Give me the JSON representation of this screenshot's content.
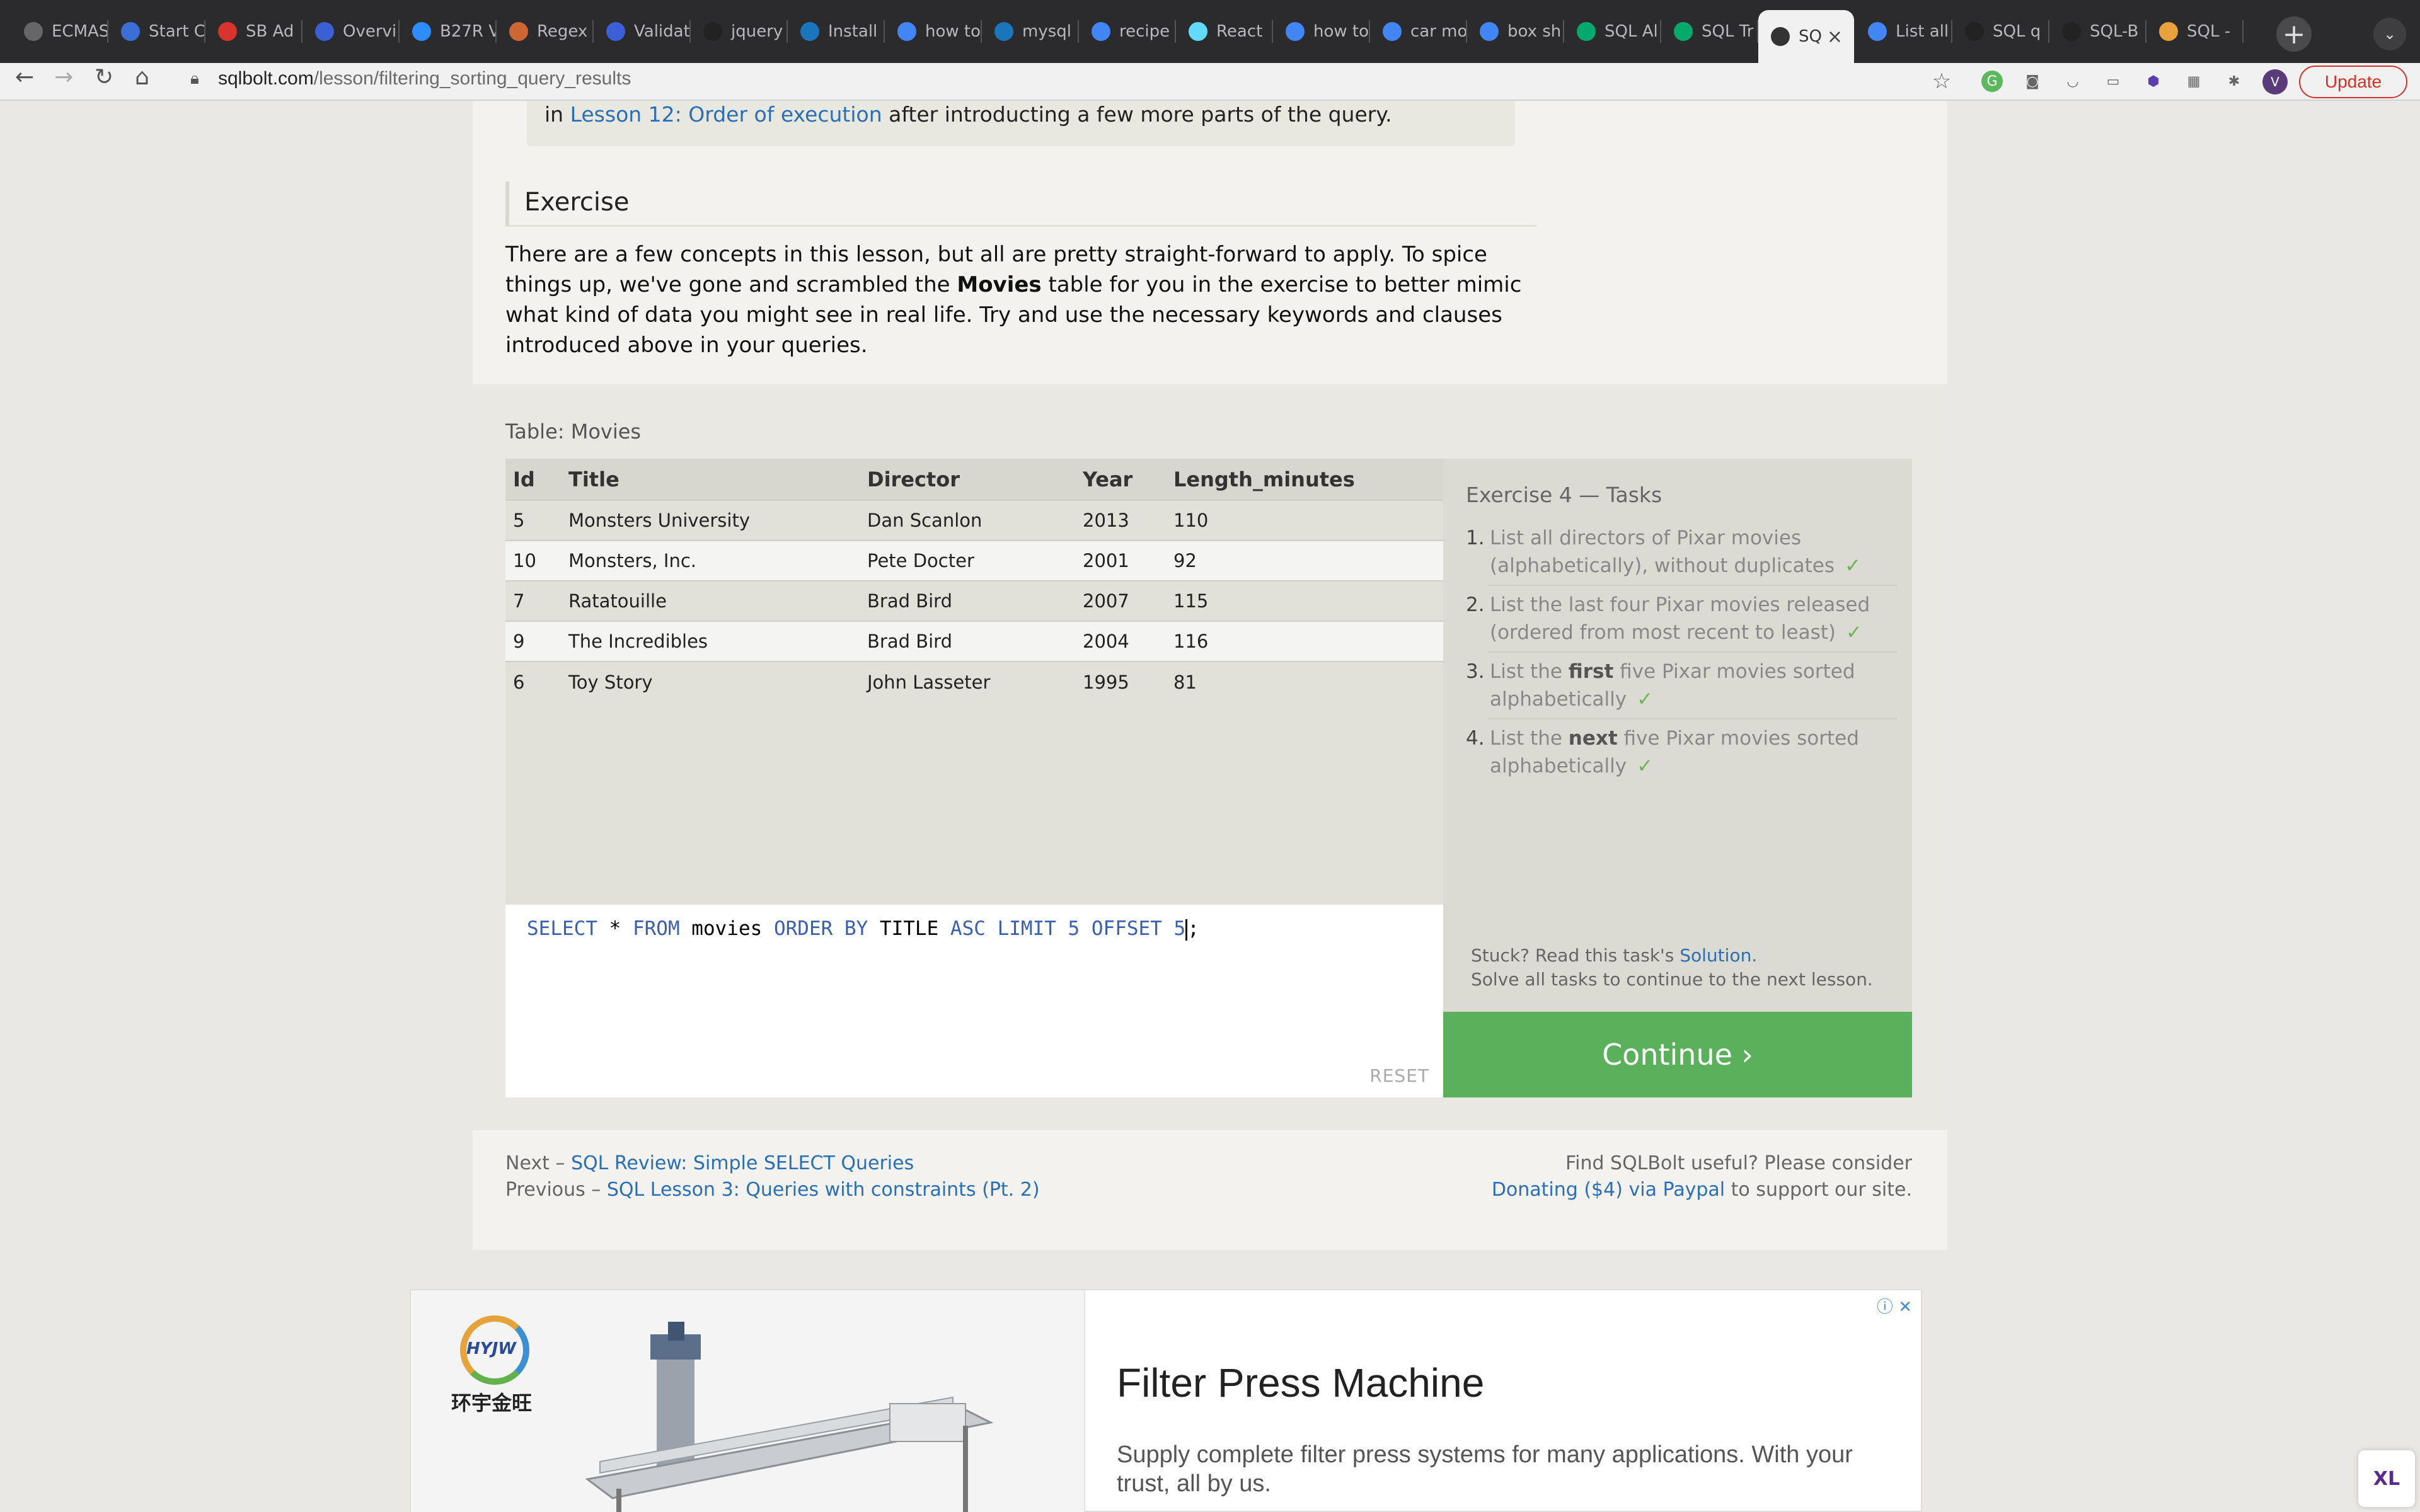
{
  "browser": {
    "tabs": [
      {
        "label": "ECMAS",
        "icon": "circle-icon",
        "color": "#666666"
      },
      {
        "label": "Start C",
        "icon": "flag-icon",
        "color": "#3b6fd6"
      },
      {
        "label": "SB Ad",
        "icon": "s-logo-icon",
        "color": "#d9342b"
      },
      {
        "label": "Overvi",
        "icon": "shield-icon",
        "color": "#3b5fd6"
      },
      {
        "label": "B27R V",
        "icon": "video-icon",
        "color": "#2d8cff"
      },
      {
        "label": "Regex",
        "icon": "regex-icon",
        "color": "#cc6633"
      },
      {
        "label": "Validat",
        "icon": "shield-icon",
        "color": "#3b5fd6"
      },
      {
        "label": "jquery",
        "icon": "github-icon",
        "color": "#222222"
      },
      {
        "label": "Install",
        "icon": "feather-icon",
        "color": "#1b75bb"
      },
      {
        "label": "how to",
        "icon": "google-icon",
        "color": "#4285f4"
      },
      {
        "label": "mysql",
        "icon": "feather-icon",
        "color": "#1b75bb"
      },
      {
        "label": "recipe",
        "icon": "google-icon",
        "color": "#4285f4"
      },
      {
        "label": "React",
        "icon": "react-icon",
        "color": "#61dafb"
      },
      {
        "label": "how to",
        "icon": "google-icon",
        "color": "#4285f4"
      },
      {
        "label": "car mo",
        "icon": "google-icon",
        "color": "#4285f4"
      },
      {
        "label": "box sh",
        "icon": "google-icon",
        "color": "#4285f4"
      },
      {
        "label": "SQL Al",
        "icon": "w3-icon",
        "color": "#04aa6d"
      },
      {
        "label": "SQL Tr",
        "icon": "w3-icon",
        "color": "#04aa6d"
      },
      {
        "label": "SQ",
        "icon": "table-icon",
        "color": "#333333",
        "active": true
      },
      {
        "label": "List all",
        "icon": "google-icon",
        "color": "#4285f4"
      },
      {
        "label": "SQL q",
        "icon": "github-icon",
        "color": "#222222"
      },
      {
        "label": "SQL-B",
        "icon": "github-icon",
        "color": "#222222"
      },
      {
        "label": "SQL -",
        "icon": "chart-icon",
        "color": "#e8a13b"
      }
    ],
    "url_host": "sqlbolt.com",
    "url_path": "/lesson/filtering_sorting_query_results",
    "update_label": "Update",
    "avatar_letter": "V"
  },
  "lesson": {
    "note_prefix": "in ",
    "note_link": "Lesson 12: Order of execution",
    "note_suffix": " after introducting a few more parts of the query.",
    "exercise_heading": "Exercise",
    "exercise_text_1": "There are a few concepts in this lesson, but all are pretty straight-forward to apply. To spice things up, we've gone and scrambled the ",
    "exercise_text_bold": "Movies",
    "exercise_text_2": " table for you in the exercise to better mimic what kind of data you might see in real life. Try and use the necessary keywords and clauses introduced above in your queries."
  },
  "table": {
    "label": "Table: Movies",
    "columns": [
      "Id",
      "Title",
      "Director",
      "Year",
      "Length_minutes"
    ],
    "rows": [
      [
        "5",
        "Monsters University",
        "Dan Scanlon",
        "2013",
        "110"
      ],
      [
        "10",
        "Monsters, Inc.",
        "Pete Docter",
        "2001",
        "92"
      ],
      [
        "7",
        "Ratatouille",
        "Brad Bird",
        "2007",
        "115"
      ],
      [
        "9",
        "The Incredibles",
        "Brad Bird",
        "2004",
        "116"
      ],
      [
        "6",
        "Toy Story",
        "John Lasseter",
        "1995",
        "81"
      ]
    ]
  },
  "editor": {
    "tokens": [
      {
        "t": "SELECT",
        "kw": true
      },
      {
        "t": " * ",
        "kw": false
      },
      {
        "t": "FROM",
        "kw": true
      },
      {
        "t": " movies ",
        "kw": false
      },
      {
        "t": "ORDER BY",
        "kw": true
      },
      {
        "t": " TITLE ",
        "kw": false
      },
      {
        "t": "ASC LIMIT 5 OFFSET 5",
        "kw": true
      },
      {
        "t": ";",
        "kw": false
      }
    ],
    "reset_label": "RESET"
  },
  "tasks": {
    "heading": "Exercise 4 — Tasks",
    "items": [
      {
        "num": "1.",
        "text": "List all directors of Pixar movies (alphabetically), without duplicates",
        "check": "✓"
      },
      {
        "num": "2.",
        "text": "List the last four Pixar movies released (ordered from most recent to least)",
        "check": "✓"
      },
      {
        "num": "3.",
        "pre": "List the ",
        "em": "first",
        "post": " five Pixar movies sorted alphabetically",
        "check": "✓"
      },
      {
        "num": "4.",
        "pre": "List the ",
        "em": "next",
        "post": " five Pixar movies sorted alphabetically",
        "check": "✓"
      }
    ],
    "stuck_prefix": "Stuck? Read this task's ",
    "stuck_link": "Solution",
    "stuck_suffix": ".",
    "solve_all": "Solve all tasks to continue to the next lesson.",
    "continue_label": "Continue ›"
  },
  "footer": {
    "next_prefix": "Next – ",
    "next_link": "SQL Review: Simple SELECT Queries",
    "prev_prefix": "Previous – ",
    "prev_link": "SQL Lesson 3: Queries with constraints (Pt. 2)",
    "find_text": "Find SQLBolt useful? Please consider",
    "donate_link": "Donating ($4) via Paypal",
    "donate_suffix": " to support our site."
  },
  "ad": {
    "brand": "HYJW",
    "brand_cn": "环宇金旺",
    "title": "Filter Press Machine",
    "text": "Supply complete filter press systems for many applications. With your trust, all by us.",
    "info_icon": "ⓘ",
    "close_icon": "✕",
    "badge": "XL"
  }
}
